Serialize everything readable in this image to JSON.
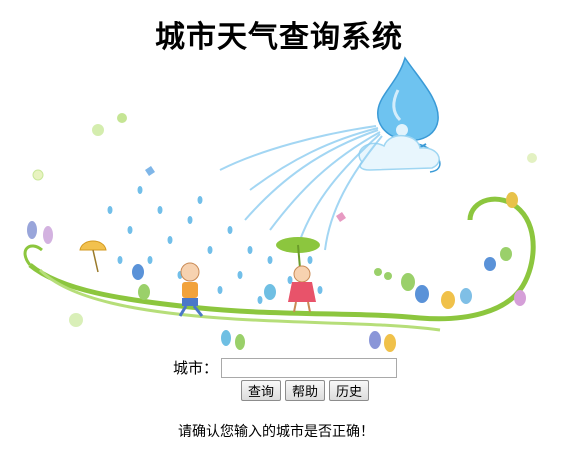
{
  "page": {
    "title": "城市天气查询系统"
  },
  "form": {
    "city_label": "城市：",
    "city_value": "",
    "city_placeholder": "",
    "buttons": {
      "query": "查询",
      "help": "帮助",
      "history": "历史"
    }
  },
  "message": "请确认您输入的城市是否正确！",
  "illustration": {
    "icon": "rain-cloud-kids-illustration-icon",
    "colors": {
      "drop": "#5ab4e6",
      "vine": "#8cc63e",
      "cloud": "#7cc8ef"
    }
  }
}
